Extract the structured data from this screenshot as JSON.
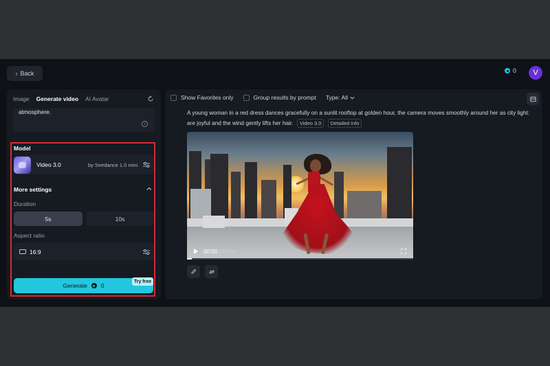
{
  "header": {
    "back_label": "Back",
    "credits": "0",
    "avatar_initial": "V"
  },
  "left_panel": {
    "tabs": [
      {
        "label": "Image",
        "active": false
      },
      {
        "label": "Generate video",
        "active": true
      },
      {
        "label": "AI Avatar",
        "active": false
      }
    ],
    "prompt_text": "atmosphere.",
    "model_section_label": "Model",
    "model": {
      "name": "Video 3.0",
      "provider": "by Seedance 1.0 mini"
    },
    "more_settings_label": "More settings",
    "duration_label": "Duration",
    "duration_options": [
      {
        "label": "5s",
        "selected": true
      },
      {
        "label": "10s",
        "selected": false
      }
    ],
    "aspect_ratio_label": "Aspect ratio",
    "aspect_ratio_value": "16:9",
    "generate_label": "Generate",
    "generate_cost": "0",
    "try_free_badge": "Try free"
  },
  "right_panel": {
    "filters": {
      "show_favorites_label": "Show Favorites only",
      "group_by_prompt_label": "Group results by prompt",
      "type_label": "Type: All"
    },
    "result": {
      "description": "A young woman in a red dress dances gracefully on a sunlit rooftop at golden hour, the camera moves smoothly around her as city light: are joyful and the wind gently lifts her hair.",
      "model_tag": "Video 3.0",
      "detail_link": "Detailed info"
    },
    "video": {
      "current_time": "00:00",
      "duration": "00:05",
      "time_separator": "/",
      "progress_fraction": 0.02
    }
  },
  "colors": {
    "accent": "#22c7dd",
    "highlight_border": "#d42b36",
    "avatar_bg": "#6a2fd8",
    "background": "#0e1116"
  },
  "icons": [
    "chevron-left-icon",
    "coin-icon",
    "refresh-icon",
    "info-icon",
    "tune-icon",
    "chevron-up-icon",
    "aspect-ratio-icon",
    "chevron-down-icon",
    "layout-icon",
    "play-icon",
    "fullscreen-icon",
    "edit-icon",
    "regenerate-icon"
  ]
}
